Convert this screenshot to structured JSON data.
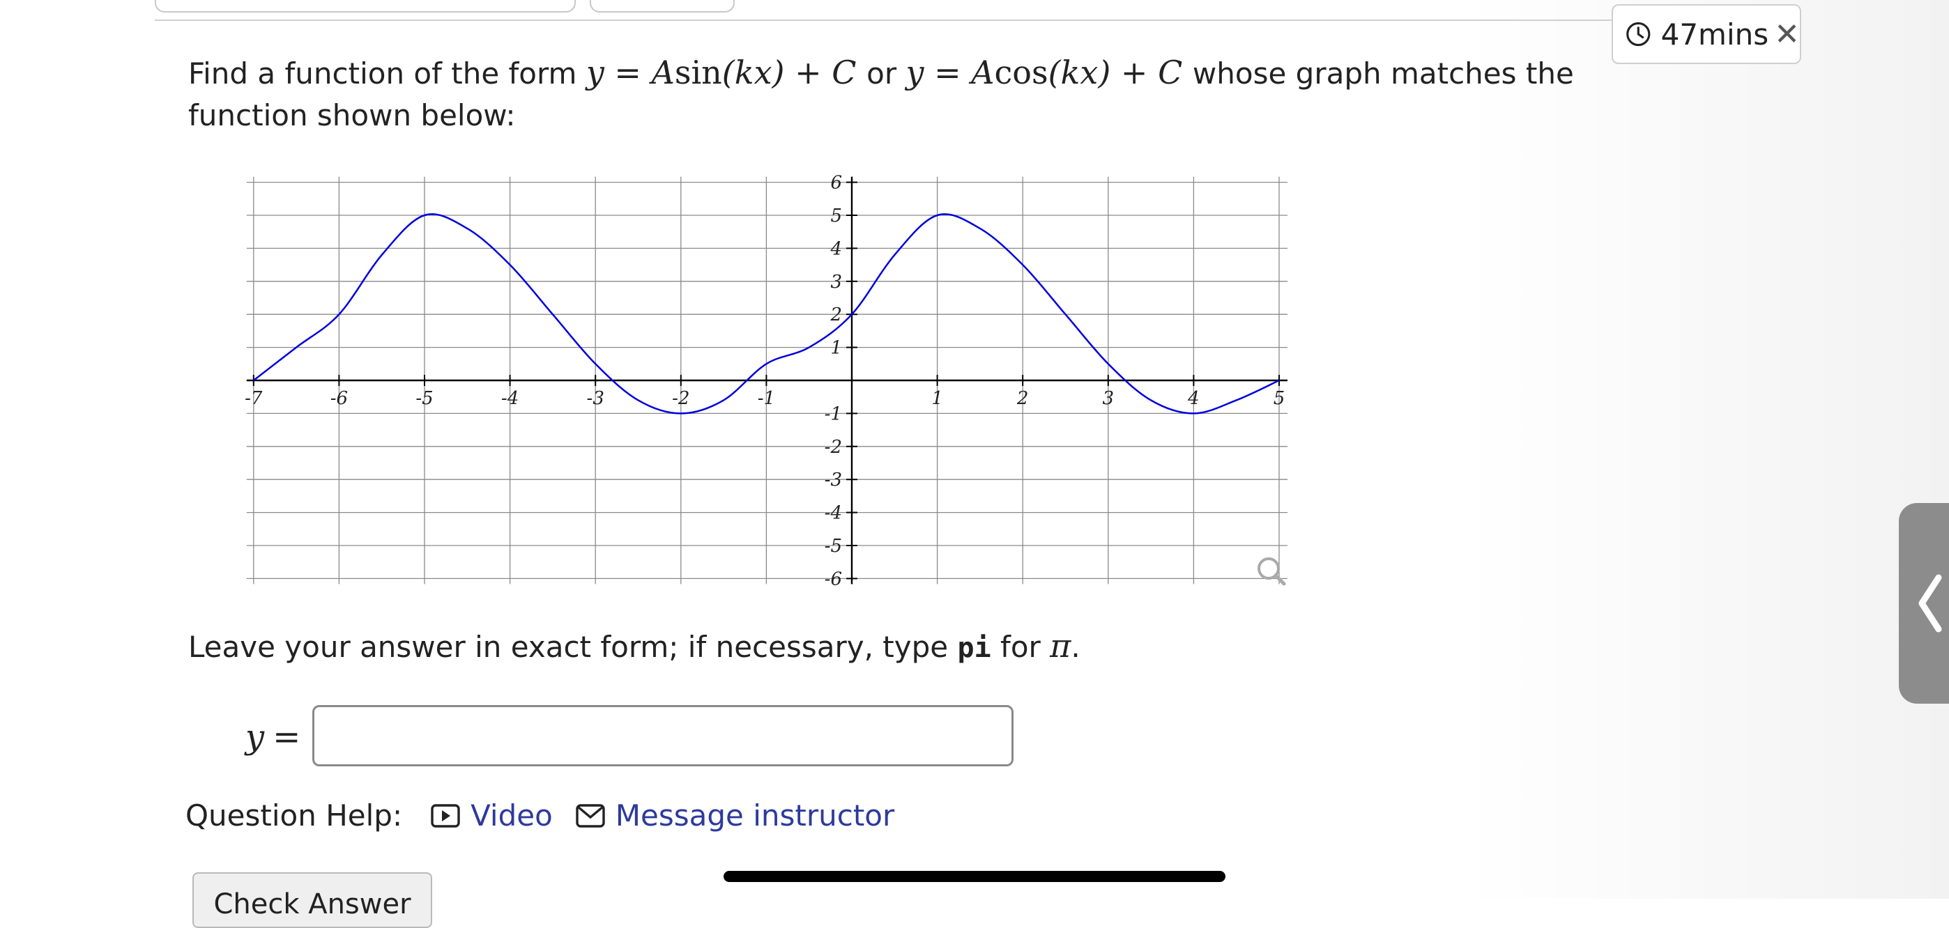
{
  "timer": {
    "text": "47mins",
    "icon": "clock-icon",
    "close_icon": "close-icon"
  },
  "question": {
    "lead": "Find a function of the form",
    "form1_left": "y",
    "form1_right_a": "A",
    "form1_func": "sin",
    "form1_arg": "(kx)",
    "form1_tail": "+ C",
    "or": "or",
    "form2_left": "y",
    "form2_right_a": "A",
    "form2_func": "cos",
    "form2_arg": "(kx)",
    "form2_tail": "+ C",
    "trail": "whose graph matches the function shown below:"
  },
  "graph": {
    "x_ticks": [
      "-7",
      "-6",
      "-5",
      "-4",
      "-3",
      "-2",
      "-1",
      "1",
      "2",
      "3",
      "4",
      "5"
    ],
    "y_ticks": [
      "6",
      "5",
      "4",
      "3",
      "2",
      "1",
      "-1",
      "-2",
      "-3",
      "-4",
      "-5",
      "-6"
    ],
    "curve_color": "#0000dd",
    "zoom_icon": "magnifier-icon"
  },
  "chart_data": {
    "type": "line",
    "xlim": [
      -7,
      5
    ],
    "ylim": [
      -6,
      6
    ],
    "grid": true,
    "x_ticks": [
      -7,
      -6,
      -5,
      -4,
      -3,
      -2,
      -1,
      1,
      2,
      3,
      4,
      5
    ],
    "y_ticks": [
      -6,
      -5,
      -4,
      -3,
      -2,
      -1,
      1,
      2,
      3,
      4,
      5,
      6
    ],
    "series": [
      {
        "x": [
          -7,
          -6.5,
          -6,
          -5.5,
          -5,
          -4.5,
          -4,
          -3.5,
          -3,
          -2.5,
          -2,
          -1.5,
          -1,
          -0.5,
          0,
          0.5,
          1,
          1.5,
          2,
          2.5,
          3,
          3.5,
          4,
          4.5,
          5
        ],
        "y": [
          0,
          1,
          2,
          3.8,
          5,
          4.6,
          3.5,
          2,
          0.5,
          -0.6,
          -1,
          -0.6,
          0.5,
          1,
          2,
          3.8,
          5,
          4.6,
          3.5,
          2,
          0.5,
          -0.6,
          -1,
          -0.6,
          0
        ],
        "color": "#0000dd"
      }
    ]
  },
  "instructions": {
    "text_before": "Leave your answer in exact form; if necessary, type",
    "code": "pi",
    "text_mid": "for",
    "symbol": "π",
    "text_end": "."
  },
  "answer": {
    "label": "y",
    "eq": "=",
    "value": ""
  },
  "help": {
    "label": "Question Help:",
    "video_label": "Video",
    "message_label": "Message instructor"
  },
  "check_button": "Check Answer",
  "side_tab": {
    "glyph": "❮",
    "icon": "chevron-left-icon"
  }
}
